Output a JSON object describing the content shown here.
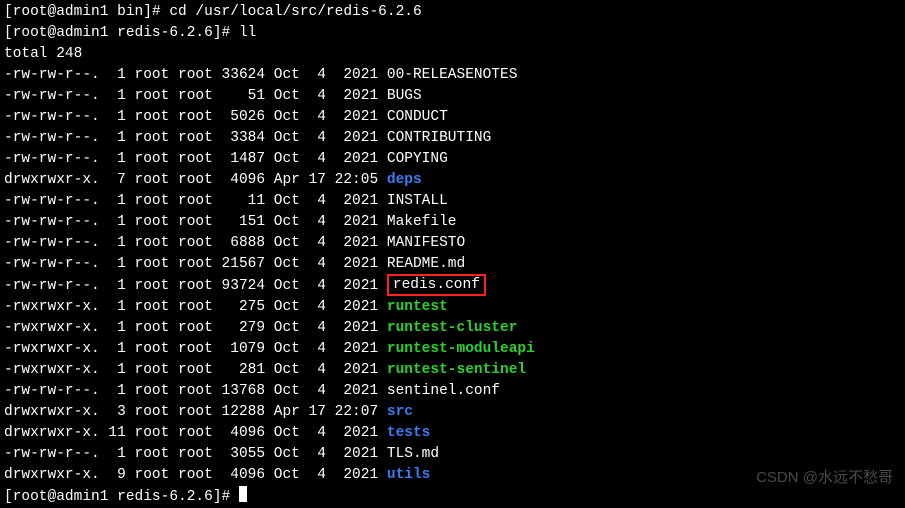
{
  "prompt1": {
    "user": "root",
    "host": "admin1",
    "cwd": "bin",
    "cmd": "cd /usr/local/src/redis-6.2.6"
  },
  "prompt2": {
    "user": "root",
    "host": "admin1",
    "cwd": "redis-6.2.6",
    "cmd": "ll"
  },
  "total_label": "total 248",
  "rows": [
    {
      "perm": "-rw-rw-r--.",
      "links": "1",
      "owner": "root",
      "group": "root",
      "size": "33624",
      "month": "Oct",
      "day": "4",
      "time": "2021",
      "name": "00-RELEASENOTES",
      "kind": "file"
    },
    {
      "perm": "-rw-rw-r--.",
      "links": "1",
      "owner": "root",
      "group": "root",
      "size": "51",
      "month": "Oct",
      "day": "4",
      "time": "2021",
      "name": "BUGS",
      "kind": "file"
    },
    {
      "perm": "-rw-rw-r--.",
      "links": "1",
      "owner": "root",
      "group": "root",
      "size": "5026",
      "month": "Oct",
      "day": "4",
      "time": "2021",
      "name": "CONDUCT",
      "kind": "file"
    },
    {
      "perm": "-rw-rw-r--.",
      "links": "1",
      "owner": "root",
      "group": "root",
      "size": "3384",
      "month": "Oct",
      "day": "4",
      "time": "2021",
      "name": "CONTRIBUTING",
      "kind": "file"
    },
    {
      "perm": "-rw-rw-r--.",
      "links": "1",
      "owner": "root",
      "group": "root",
      "size": "1487",
      "month": "Oct",
      "day": "4",
      "time": "2021",
      "name": "COPYING",
      "kind": "file"
    },
    {
      "perm": "drwxrwxr-x.",
      "links": "7",
      "owner": "root",
      "group": "root",
      "size": "4096",
      "month": "Apr",
      "day": "17",
      "time": "22:05",
      "name": "deps",
      "kind": "dir"
    },
    {
      "perm": "-rw-rw-r--.",
      "links": "1",
      "owner": "root",
      "group": "root",
      "size": "11",
      "month": "Oct",
      "day": "4",
      "time": "2021",
      "name": "INSTALL",
      "kind": "file"
    },
    {
      "perm": "-rw-rw-r--.",
      "links": "1",
      "owner": "root",
      "group": "root",
      "size": "151",
      "month": "Oct",
      "day": "4",
      "time": "2021",
      "name": "Makefile",
      "kind": "file"
    },
    {
      "perm": "-rw-rw-r--.",
      "links": "1",
      "owner": "root",
      "group": "root",
      "size": "6888",
      "month": "Oct",
      "day": "4",
      "time": "2021",
      "name": "MANIFESTO",
      "kind": "file"
    },
    {
      "perm": "-rw-rw-r--.",
      "links": "1",
      "owner": "root",
      "group": "root",
      "size": "21567",
      "month": "Oct",
      "day": "4",
      "time": "2021",
      "name": "README.md",
      "kind": "file"
    },
    {
      "perm": "-rw-rw-r--.",
      "links": "1",
      "owner": "root",
      "group": "root",
      "size": "93724",
      "month": "Oct",
      "day": "4",
      "time": "2021",
      "name": "redis.conf",
      "kind": "file",
      "highlighted": true
    },
    {
      "perm": "-rwxrwxr-x.",
      "links": "1",
      "owner": "root",
      "group": "root",
      "size": "275",
      "month": "Oct",
      "day": "4",
      "time": "2021",
      "name": "runtest",
      "kind": "exe"
    },
    {
      "perm": "-rwxrwxr-x.",
      "links": "1",
      "owner": "root",
      "group": "root",
      "size": "279",
      "month": "Oct",
      "day": "4",
      "time": "2021",
      "name": "runtest-cluster",
      "kind": "exe"
    },
    {
      "perm": "-rwxrwxr-x.",
      "links": "1",
      "owner": "root",
      "group": "root",
      "size": "1079",
      "month": "Oct",
      "day": "4",
      "time": "2021",
      "name": "runtest-moduleapi",
      "kind": "exe"
    },
    {
      "perm": "-rwxrwxr-x.",
      "links": "1",
      "owner": "root",
      "group": "root",
      "size": "281",
      "month": "Oct",
      "day": "4",
      "time": "2021",
      "name": "runtest-sentinel",
      "kind": "exe"
    },
    {
      "perm": "-rw-rw-r--.",
      "links": "1",
      "owner": "root",
      "group": "root",
      "size": "13768",
      "month": "Oct",
      "day": "4",
      "time": "2021",
      "name": "sentinel.conf",
      "kind": "file"
    },
    {
      "perm": "drwxrwxr-x.",
      "links": "3",
      "owner": "root",
      "group": "root",
      "size": "12288",
      "month": "Apr",
      "day": "17",
      "time": "22:07",
      "name": "src",
      "kind": "dir"
    },
    {
      "perm": "drwxrwxr-x.",
      "links": "11",
      "owner": "root",
      "group": "root",
      "size": "4096",
      "month": "Oct",
      "day": "4",
      "time": "2021",
      "name": "tests",
      "kind": "dir"
    },
    {
      "perm": "-rw-rw-r--.",
      "links": "1",
      "owner": "root",
      "group": "root",
      "size": "3055",
      "month": "Oct",
      "day": "4",
      "time": "2021",
      "name": "TLS.md",
      "kind": "file"
    },
    {
      "perm": "drwxrwxr-x.",
      "links": "9",
      "owner": "root",
      "group": "root",
      "size": "4096",
      "month": "Oct",
      "day": "4",
      "time": "2021",
      "name": "utils",
      "kind": "dir"
    }
  ],
  "prompt3": {
    "user": "root",
    "host": "admin1",
    "cwd": "redis-6.2.6",
    "cmd": ""
  },
  "watermark": "CSDN @水远不愁哥"
}
